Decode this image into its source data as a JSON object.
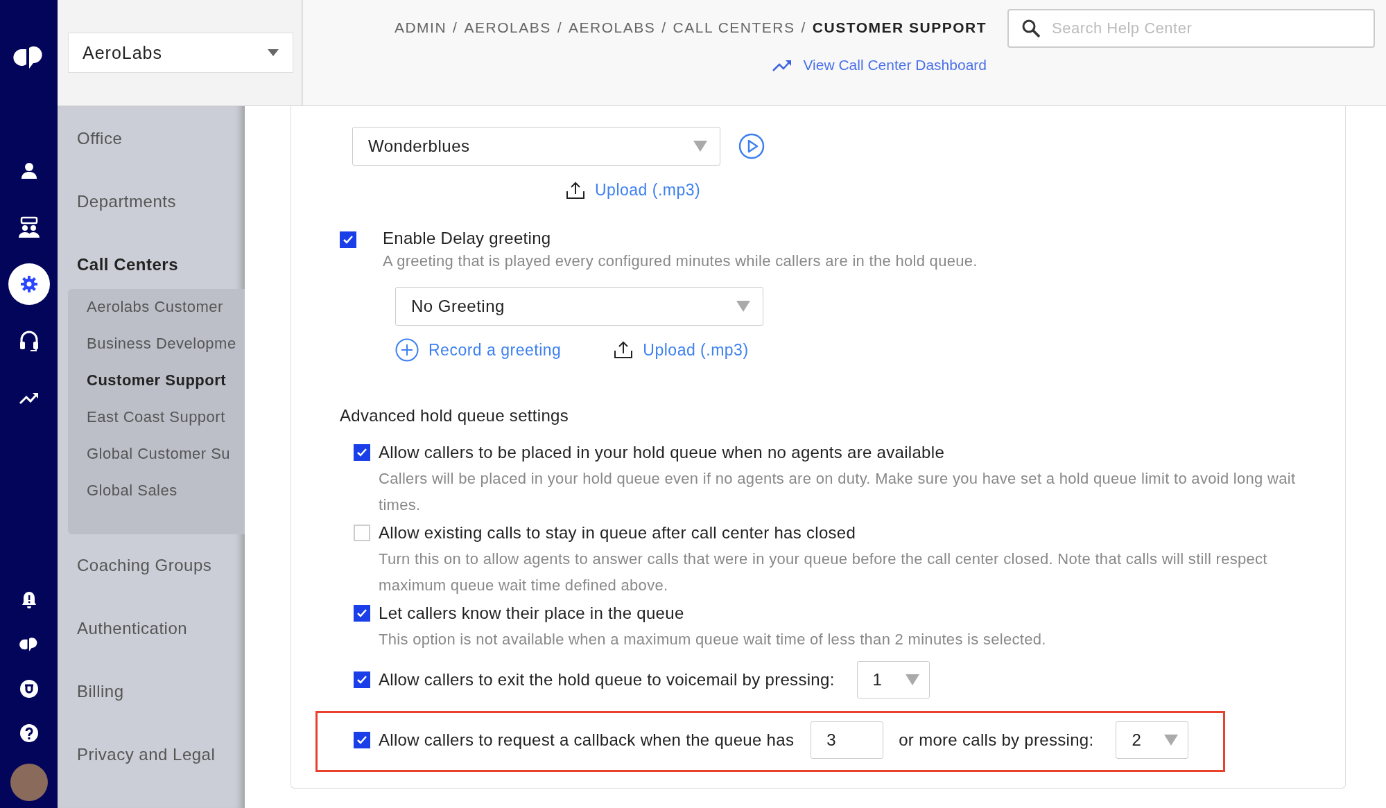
{
  "rail": {
    "top": [
      {
        "kind": "person",
        "selected": false
      },
      {
        "kind": "people",
        "selected": false
      },
      {
        "kind": "gear",
        "selected": true
      },
      {
        "kind": "headset",
        "selected": false
      },
      {
        "kind": "trend",
        "selected": false
      }
    ],
    "bottom": [
      {
        "kind": "bell",
        "selected": false
      },
      {
        "kind": "logo",
        "selected": false
      },
      {
        "kind": "badge",
        "selected": false
      },
      {
        "kind": "help",
        "selected": false
      },
      {
        "kind": "avatar",
        "selected": false
      }
    ]
  },
  "org_selector": {
    "value": "AeroLabs"
  },
  "sidebar": {
    "items": [
      {
        "label": "Office",
        "selected": false
      },
      {
        "label": "Departments",
        "selected": false
      },
      {
        "label": "Call Centers",
        "selected": true,
        "children": [
          {
            "label": "Aerolabs Customer",
            "selected": false
          },
          {
            "label": "Business Developme",
            "selected": false
          },
          {
            "label": "Customer Support",
            "selected": true
          },
          {
            "label": "East Coast Support",
            "selected": false
          },
          {
            "label": "Global Customer Su",
            "selected": false
          },
          {
            "label": "Global Sales",
            "selected": false
          }
        ]
      },
      {
        "label": "Coaching Groups",
        "selected": false
      },
      {
        "label": "Authentication",
        "selected": false
      },
      {
        "label": "Billing",
        "selected": false
      },
      {
        "label": "Privacy and Legal",
        "selected": false
      }
    ]
  },
  "breadcrumb": {
    "separator": "/",
    "items": [
      {
        "label": "ADMIN",
        "current": false
      },
      {
        "label": "AEROLABS",
        "current": false
      },
      {
        "label": "AEROLABS",
        "current": false
      },
      {
        "label": "CALL CENTERS",
        "current": false
      },
      {
        "label": "CUSTOMER SUPPORT",
        "current": true
      }
    ]
  },
  "search": {
    "placeholder": "Search Help Center"
  },
  "dashboard_link": "View Call Center Dashboard",
  "hold_music": {
    "value": "Wonderblues",
    "upload": "Upload (.mp3)"
  },
  "delay_greeting": {
    "checked": true,
    "label": "Enable Delay greeting",
    "description": "A greeting that is played every configured minutes while callers are in the hold queue.",
    "value": "No Greeting",
    "record": "Record a greeting",
    "upload": "Upload (.mp3)"
  },
  "advanced": {
    "title": "Advanced hold queue settings",
    "options": [
      {
        "kind": "plain",
        "checked": true,
        "highlighted": false,
        "label": "Allow callers to be placed in your hold queue when no agents are available",
        "description": "Callers will be placed in your hold queue even if no agents are on duty. Make sure you have set a hold queue limit to avoid long wait times."
      },
      {
        "kind": "plain",
        "checked": false,
        "highlighted": false,
        "label": "Allow existing calls to stay in queue after call center has closed",
        "description": "Turn this on to allow agents to answer calls that were in your queue before the call center closed. Note that calls will still respect maximum queue wait time defined above."
      },
      {
        "kind": "plain",
        "checked": true,
        "highlighted": false,
        "label": "Let callers know their place in the queue",
        "description": "This option is not available when a maximum queue wait time of less than 2 minutes is selected."
      },
      {
        "kind": "select",
        "checked": true,
        "highlighted": false,
        "label": "Allow callers to exit the hold queue to voicemail by pressing:",
        "value": "1"
      },
      {
        "kind": "callback",
        "checked": true,
        "highlighted": true,
        "label": "Allow callers to request a callback when the queue has",
        "count": "3",
        "suffix": "or more calls by pressing:",
        "value": "2"
      }
    ]
  }
}
